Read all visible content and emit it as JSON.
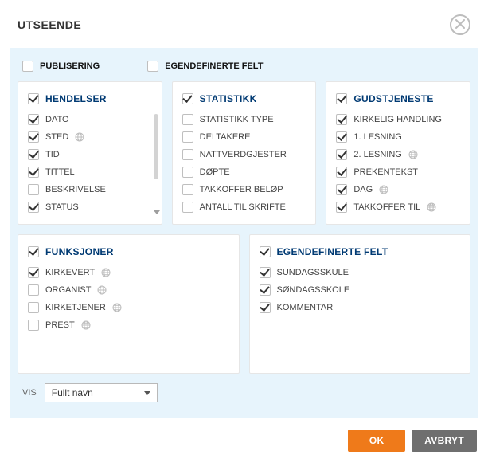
{
  "dialog": {
    "title": "UTSEENDE"
  },
  "topChecks": {
    "publisering": {
      "label": "PUBLISERING",
      "checked": false
    },
    "egendef": {
      "label": "EGENDEFINERTE FELT",
      "checked": false
    }
  },
  "cards": {
    "hendelser": {
      "title": "HENDELSER",
      "headerChecked": true,
      "items": [
        {
          "label": "DATO",
          "checked": true,
          "globe": false
        },
        {
          "label": "STED",
          "checked": true,
          "globe": true
        },
        {
          "label": "TID",
          "checked": true,
          "globe": false
        },
        {
          "label": "TITTEL",
          "checked": true,
          "globe": false
        },
        {
          "label": "BESKRIVELSE",
          "checked": false,
          "globe": false
        },
        {
          "label": "STATUS",
          "checked": true,
          "globe": false
        }
      ]
    },
    "statistikk": {
      "title": "STATISTIKK",
      "headerChecked": true,
      "items": [
        {
          "label": "STATISTIKK TYPE",
          "checked": false,
          "globe": false
        },
        {
          "label": "DELTAKERE",
          "checked": false,
          "globe": false
        },
        {
          "label": "NATTVERDGJESTER",
          "checked": false,
          "globe": false
        },
        {
          "label": "DØPTE",
          "checked": false,
          "globe": false
        },
        {
          "label": "TAKKOFFER BELØP",
          "checked": false,
          "globe": false
        },
        {
          "label": "ANTALL TIL SKRIFTE",
          "checked": false,
          "globe": false
        }
      ]
    },
    "gudstjeneste": {
      "title": "GUDSTJENESTE",
      "headerChecked": true,
      "items": [
        {
          "label": "KIRKELIG HANDLING",
          "checked": true,
          "globe": false
        },
        {
          "label": "1. LESNING",
          "checked": true,
          "globe": false
        },
        {
          "label": "2. LESNING",
          "checked": true,
          "globe": true
        },
        {
          "label": "PREKENTEKST",
          "checked": true,
          "globe": false
        },
        {
          "label": "DAG",
          "checked": true,
          "globe": true
        },
        {
          "label": "TAKKOFFER TIL",
          "checked": true,
          "globe": true
        }
      ]
    },
    "funksjoner": {
      "title": "FUNKSJONER",
      "headerChecked": true,
      "items": [
        {
          "label": "KIRKEVERT",
          "checked": true,
          "globe": true
        },
        {
          "label": "ORGANIST",
          "checked": false,
          "globe": true
        },
        {
          "label": "KIRKETJENER",
          "checked": false,
          "globe": true
        },
        {
          "label": "PREST",
          "checked": false,
          "globe": true
        }
      ]
    },
    "egendefFelt": {
      "title": "EGENDEFINERTE FELT",
      "headerChecked": true,
      "items": [
        {
          "label": "SUNDAGSSKULE",
          "checked": true,
          "globe": false
        },
        {
          "label": "SØNDAGSSKOLE",
          "checked": true,
          "globe": false
        },
        {
          "label": "KOMMENTAR",
          "checked": true,
          "globe": false
        }
      ]
    }
  },
  "vis": {
    "label": "VIS",
    "selected": "Fullt navn"
  },
  "footer": {
    "ok": "OK",
    "cancel": "AVBRYT"
  }
}
